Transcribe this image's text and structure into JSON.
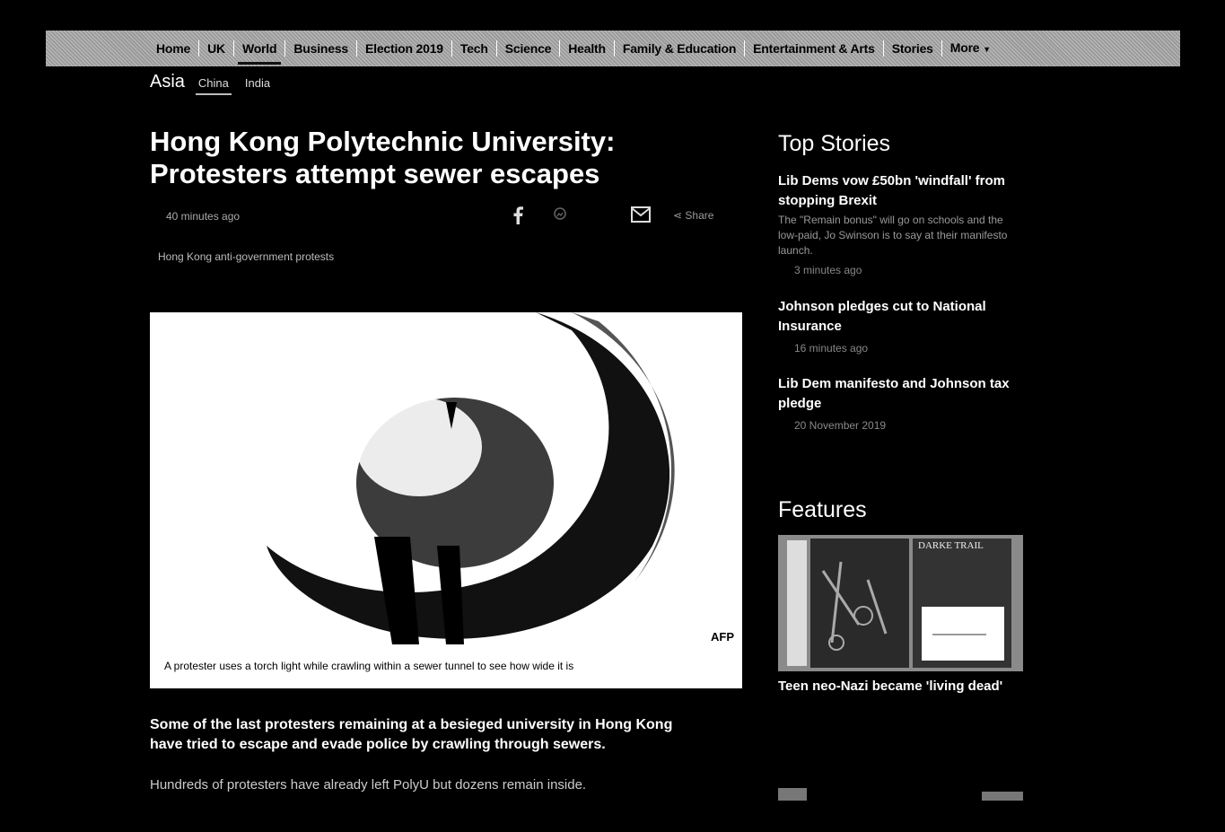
{
  "nav": {
    "items": [
      "Home",
      "UK",
      "World",
      "Business",
      "Election 2019",
      "Tech",
      "Science",
      "Health",
      "Family & Education",
      "Entertainment & Arts",
      "Stories",
      "More"
    ],
    "active": "World",
    "more_icon": "caret-down-icon"
  },
  "subnav": {
    "section": "Asia",
    "items": [
      "China",
      "India"
    ]
  },
  "article": {
    "headline": "Hong Kong Polytechnic University: Protesters attempt sewer escapes",
    "timestamp": "40 minutes ago",
    "share_label": "Share",
    "tag": "Hong Kong anti-government protests",
    "image_credit": "AFP",
    "image_caption": "A protester uses a torch light while crawling within a sewer tunnel to see how wide it is",
    "lead": "Some of the last protesters remaining at a besieged university in Hong Kong have tried to escape and evade police by crawling through sewers.",
    "para1": "Hundreds of protesters have already left PolyU but dozens remain inside."
  },
  "sidebar": {
    "top_stories_heading": "Top Stories",
    "stories": [
      {
        "title": "Lib Dems vow £50bn 'windfall' from stopping Brexit",
        "summary": "The \"Remain bonus\" will go on schools and the low-paid, Jo Swinson is to say at their manifesto launch.",
        "time": "3 minutes ago"
      },
      {
        "title": "Johnson pledges cut to National Insurance",
        "summary": "",
        "time": "16 minutes ago"
      },
      {
        "title": "Lib Dem manifesto and Johnson tax pledge",
        "summary": "",
        "time": "20 November 2019"
      }
    ],
    "features_heading": "Features",
    "feature": {
      "title": "Teen neo-Nazi became 'living dead'",
      "image_text": "DARKE TRAIL"
    }
  }
}
